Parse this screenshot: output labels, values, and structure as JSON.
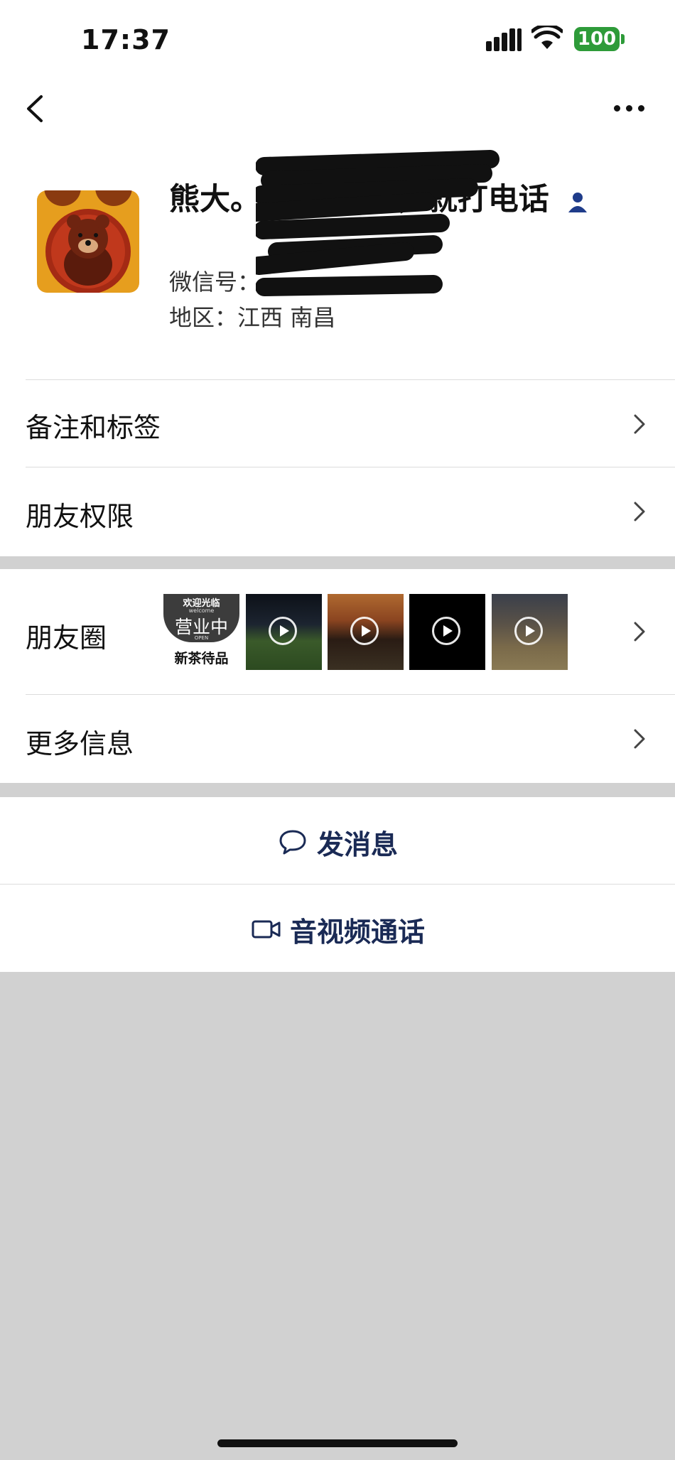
{
  "status_bar": {
    "time": "17:37",
    "battery": "100"
  },
  "profile": {
    "nickname": "熊大。                    000不回，就打电话",
    "wechat_id_label": "微信号：",
    "region_label": "地区：",
    "region_value": "江西 南昌"
  },
  "rows": {
    "remark_tags": "备注和标签",
    "friend_permissions": "朋友权限",
    "moments": "朋友圈",
    "more_info": "更多信息"
  },
  "moments_thumbs": {
    "first_top": "欢迎光临",
    "first_small": "welcome",
    "first_main": "营业中",
    "first_open": "OPEN",
    "first_bottom": "新茶待品"
  },
  "actions": {
    "send_message": "发消息",
    "av_call": "音视频通话"
  },
  "colors": {
    "accent": "#1a2a55",
    "battery": "#2e9b39",
    "background": "#d1d1d1"
  },
  "icons": [
    "back-icon",
    "more-icon",
    "chat-bubble-icon",
    "video-camera-icon",
    "chevron-right-icon",
    "play-icon"
  ]
}
